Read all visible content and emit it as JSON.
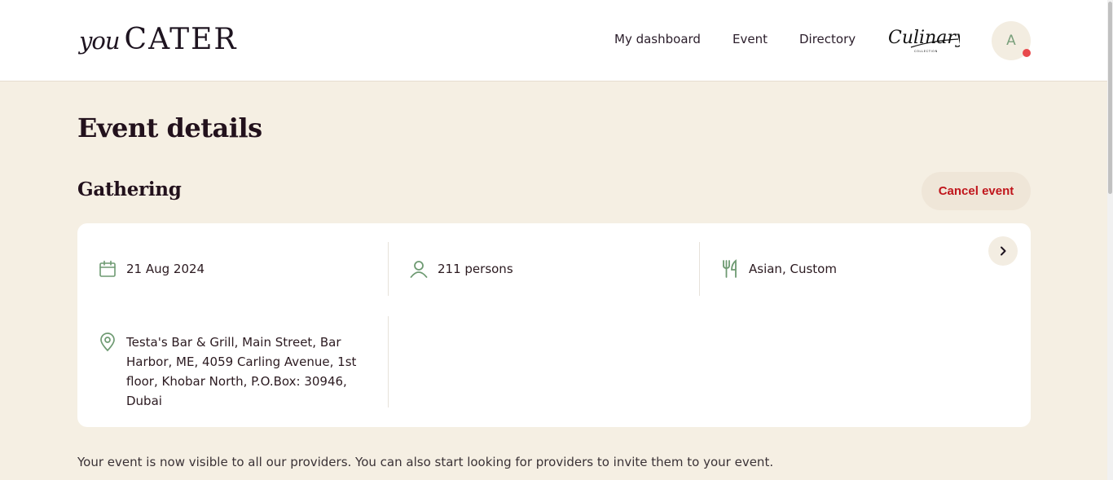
{
  "header": {
    "logo_prefix": "you",
    "logo_main": "CATER",
    "nav": {
      "dashboard": "My dashboard",
      "event": "Event",
      "directory": "Directory"
    },
    "partner_logo_text": "Culinary",
    "partner_logo_sub": "COLLECTION",
    "avatar_initial": "A"
  },
  "page": {
    "title": "Event details"
  },
  "event": {
    "name": "Gathering",
    "cancel_label": "Cancel event",
    "date": "21 Aug 2024",
    "guests": "211 persons",
    "cuisine": "Asian, Custom",
    "location": "Testa's Bar & Grill, Main Street, Bar Harbor, ME, 4059 Carling Avenue, 1st floor, Khobar North, P.O.Box: 30946, Dubai"
  },
  "info_message": "Your event is now visible to all our providers. You can also start looking for providers to invite them to your event.",
  "icons": {
    "date": "calendar-icon",
    "guests": "person-icon",
    "cuisine": "cutlery-icon",
    "location": "map-pin-icon",
    "expand": "chevron-right-icon"
  },
  "colors": {
    "background": "#f5efe3",
    "accent_green": "#6e9a72",
    "cancel_red": "#c0151b",
    "notification_dot": "#e8494c"
  }
}
